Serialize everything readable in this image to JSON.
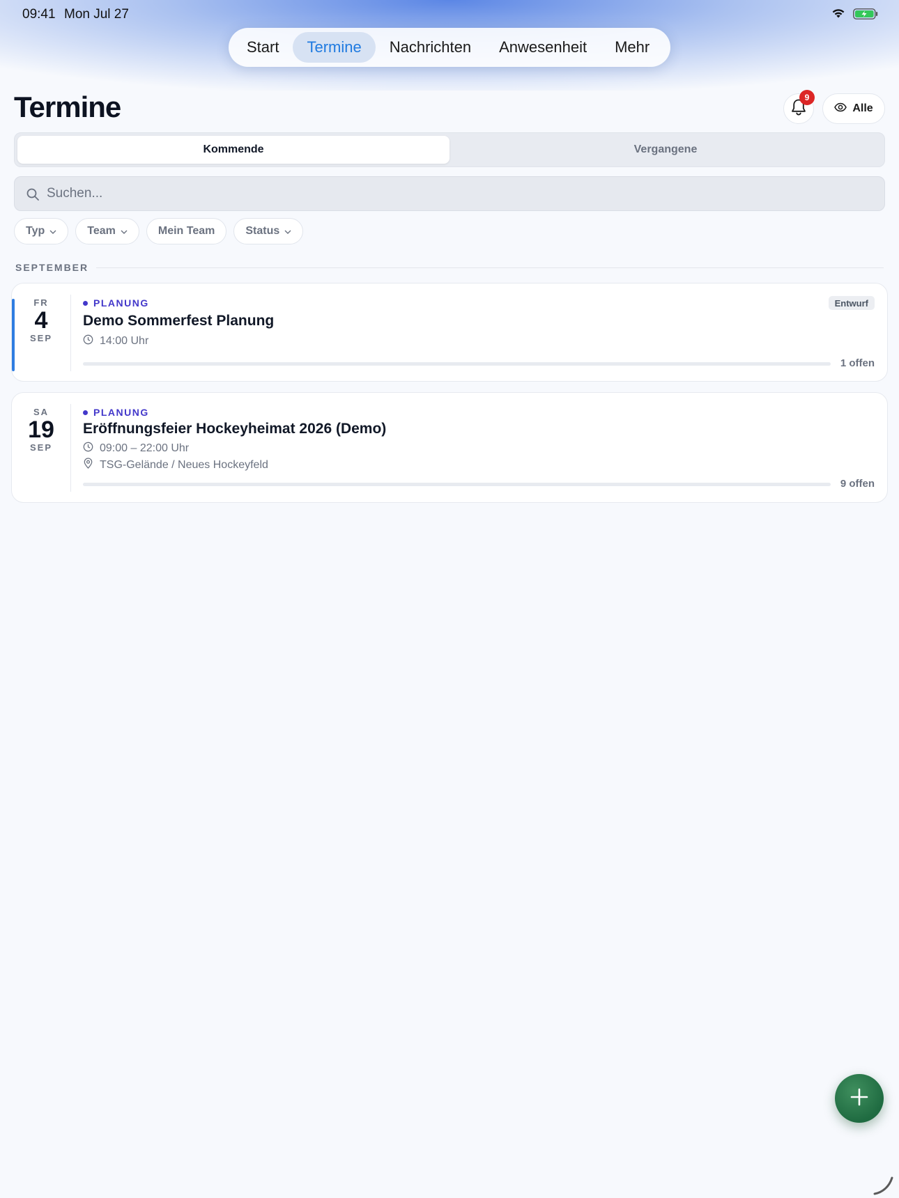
{
  "status_bar": {
    "time": "09:41",
    "date": "Mon Jul 27"
  },
  "nav": {
    "tabs": [
      {
        "label": "Start",
        "active": false
      },
      {
        "label": "Termine",
        "active": true
      },
      {
        "label": "Nachrichten",
        "active": false
      },
      {
        "label": "Anwesenheit",
        "active": false
      },
      {
        "label": "Mehr",
        "active": false
      }
    ]
  },
  "header": {
    "title": "Termine",
    "notification_count": "9",
    "visibility_label": "Alle"
  },
  "segments": {
    "upcoming": "Kommende",
    "past": "Vergangene",
    "selected": "Kommende"
  },
  "search": {
    "placeholder": "Suchen...",
    "value": ""
  },
  "filters": [
    {
      "label": "Typ",
      "dropdown": true
    },
    {
      "label": "Team",
      "dropdown": true
    },
    {
      "label": "Mein Team",
      "dropdown": false
    },
    {
      "label": "Status",
      "dropdown": true
    }
  ],
  "section": {
    "label": "SEPTEMBER"
  },
  "events": [
    {
      "dow": "FR",
      "day": "4",
      "month": "SEP",
      "category": "PLANUNG",
      "title": "Demo Sommerfest Planung",
      "time": "14:00 Uhr",
      "badge": "Entwurf",
      "open_label": "1 offen",
      "progress": 0
    },
    {
      "dow": "SA",
      "day": "19",
      "month": "SEP",
      "category": "PLANUNG",
      "title": "Eröffnungsfeier Hockeyheimat 2026 (Demo)",
      "time": "09:00 – 22:00 Uhr",
      "location": "TSG-Gelände / Neues Hockeyfeld",
      "open_label": "9 offen",
      "progress": 0
    }
  ],
  "colors": {
    "accent": "#1f7ae0",
    "category": "#4338ca",
    "fab": "#1f6b41",
    "badge": "#dc2626"
  }
}
